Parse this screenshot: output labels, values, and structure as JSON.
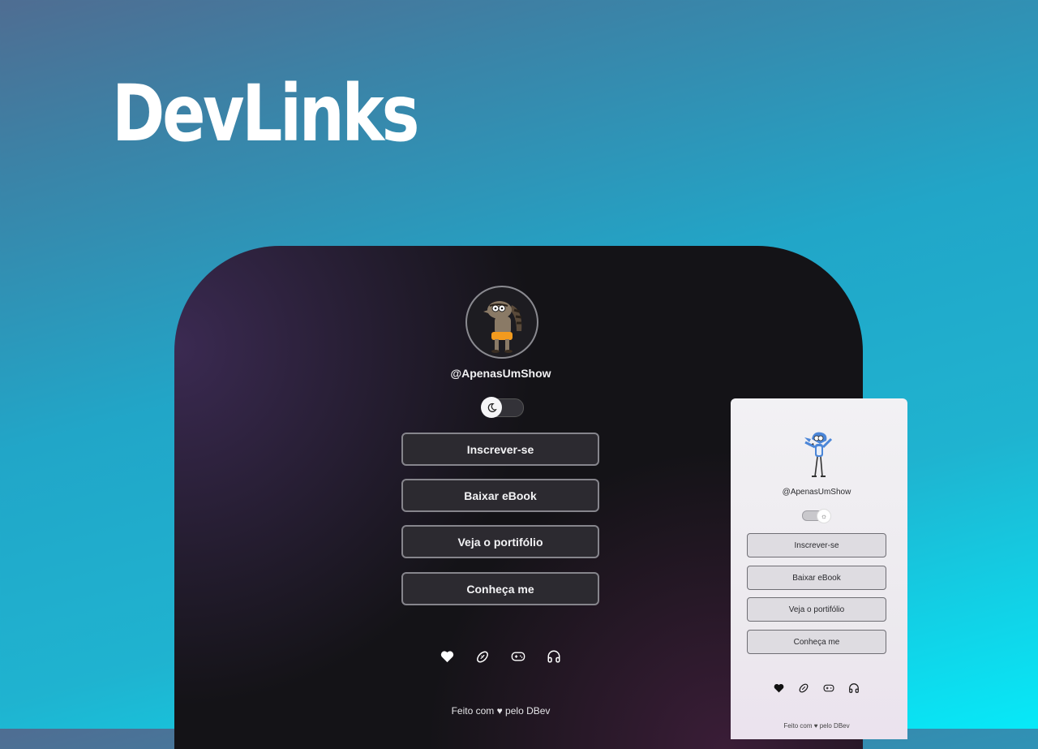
{
  "page": {
    "title": "DevLinks"
  },
  "dark_preview": {
    "handle": "@ApenasUmShow",
    "toggle_icon": "moon-icon",
    "buttons": [
      "Inscrever-se",
      "Baixar eBook",
      "Veja o portifólio",
      "Conheça me"
    ],
    "social_icons": [
      "heart-icon",
      "football-icon",
      "gamepad-icon",
      "headphones-icon"
    ],
    "footer": "Feito com ♥ pelo DBev"
  },
  "light_preview": {
    "handle": "@ApenasUmShow",
    "toggle_icon": "sun-icon",
    "buttons": [
      "Inscrever-se",
      "Baixar eBook",
      "Veja o portifólio",
      "Conheça me"
    ],
    "social_icons": [
      "heart-icon",
      "football-icon",
      "gamepad-icon",
      "headphones-icon"
    ],
    "footer": "Feito com ♥ pelo DBev"
  },
  "colors": {
    "dark_bg": "#141317",
    "dark_button": "#2c2a30",
    "light_button": "#dedce1",
    "accent_cyan": "#07e9f8"
  }
}
